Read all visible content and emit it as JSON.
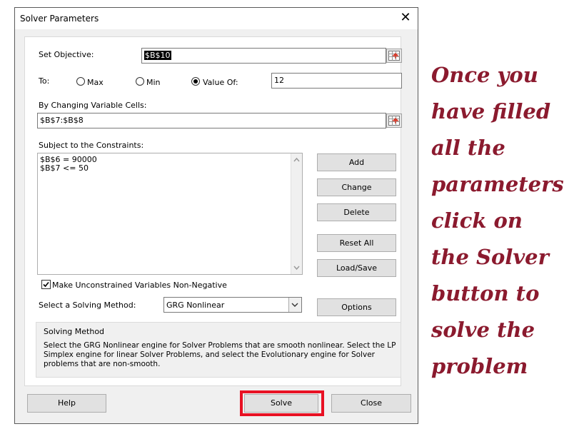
{
  "dialog": {
    "title": "Solver Parameters",
    "close_label": "✕"
  },
  "objective": {
    "label": "Set Objective:",
    "value": "$B$10"
  },
  "to": {
    "label": "To:",
    "options": [
      "Max",
      "Min",
      "Value Of:"
    ],
    "selected": "Value Of:",
    "value_of": "12"
  },
  "changing": {
    "label": "By Changing Variable Cells:",
    "value": "$B$7:$B$8"
  },
  "constraints": {
    "label": "Subject to the Constraints:",
    "items": [
      "$B$6 = 90000",
      "$B$7 <= 50"
    ]
  },
  "side_buttons": {
    "add": "Add",
    "change": "Change",
    "delete": "Delete",
    "reset_all": "Reset All",
    "load_save": "Load/Save",
    "options": "Options"
  },
  "nonneg": {
    "label": "Make Unconstrained Variables Non-Negative",
    "checked": true
  },
  "method": {
    "label": "Select a Solving Method:",
    "value": "GRG Nonlinear"
  },
  "solving_method": {
    "title": "Solving Method",
    "description": "Select the GRG Nonlinear engine for Solver Problems that are smooth nonlinear. Select the LP Simplex engine for linear Solver Problems, and select the Evolutionary engine for Solver problems that are non-smooth."
  },
  "footer": {
    "help": "Help",
    "solve": "Solve",
    "close": "Close"
  },
  "annotation": {
    "lines": [
      "Once you",
      "have filled",
      "all the",
      "parameters",
      "click on",
      "the Solver",
      "button to",
      "solve the",
      "problem"
    ],
    "color": "#8b1a2e"
  },
  "colors": {
    "highlight": "#e81123"
  }
}
